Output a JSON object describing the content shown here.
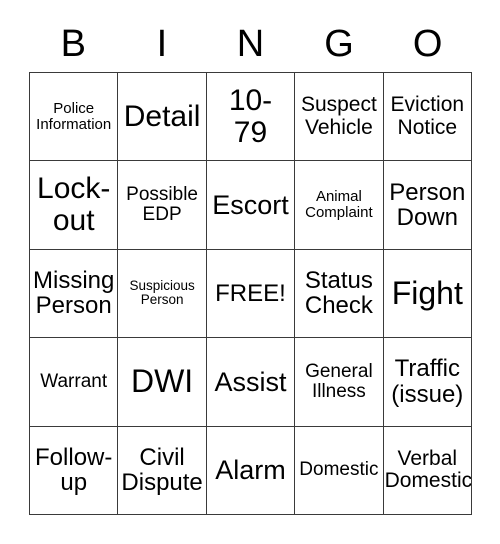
{
  "card": {
    "type": "bingo-card",
    "columns": 5,
    "rows": 5,
    "free_space_label": "FREE!",
    "border_color": "#3a3a3a",
    "background_color": "#ffffff",
    "text_color": "#000000"
  },
  "header": {
    "letters": [
      "B",
      "I",
      "N",
      "G",
      "O"
    ]
  },
  "grid": {
    "cells": [
      {
        "text": "Police\nInformation",
        "size": "fs-s",
        "name": "cell-police-information"
      },
      {
        "text": "Detail",
        "size": "fs-xxl",
        "name": "cell-detail"
      },
      {
        "text": "10-\n79",
        "size": "fs-xxl",
        "name": "cell-10-79"
      },
      {
        "text": "Suspect\nVehicle",
        "size": "fs-ml",
        "name": "cell-suspect-vehicle"
      },
      {
        "text": "Eviction\nNotice",
        "size": "fs-ml",
        "name": "cell-eviction-notice"
      },
      {
        "text": "Lock-\nout",
        "size": "fs-xxl",
        "name": "cell-lockout"
      },
      {
        "text": "Possible\nEDP",
        "size": "fs-m",
        "name": "cell-possible-edp"
      },
      {
        "text": "Escort",
        "size": "fs-xl",
        "name": "cell-escort"
      },
      {
        "text": "Animal\nComplaint",
        "size": "fs-s",
        "name": "cell-animal-complaint"
      },
      {
        "text": "Person\nDown",
        "size": "fs-l",
        "name": "cell-person-down"
      },
      {
        "text": "Missing\nPerson",
        "size": "fs-l",
        "name": "cell-missing-person"
      },
      {
        "text": "Suspicious\nPerson",
        "size": "fs-xs",
        "name": "cell-suspicious-person"
      },
      {
        "text": "FREE!",
        "size": "fs-l",
        "name": "cell-free-space"
      },
      {
        "text": "Status\nCheck",
        "size": "fs-l",
        "name": "cell-status-check"
      },
      {
        "text": "Fight",
        "size": "fs-huge",
        "name": "cell-fight"
      },
      {
        "text": "Warrant",
        "size": "fs-m",
        "name": "cell-warrant"
      },
      {
        "text": "DWI",
        "size": "fs-huge",
        "name": "cell-dwi"
      },
      {
        "text": "Assist",
        "size": "fs-xl",
        "name": "cell-assist"
      },
      {
        "text": "General\nIllness",
        "size": "fs-m",
        "name": "cell-general-illness"
      },
      {
        "text": "Traffic\n(issue)",
        "size": "fs-l",
        "name": "cell-traffic-issue"
      },
      {
        "text": "Follow-\nup",
        "size": "fs-l",
        "name": "cell-follow-up"
      },
      {
        "text": "Civil\nDispute",
        "size": "fs-l",
        "name": "cell-civil-dispute"
      },
      {
        "text": "Alarm",
        "size": "fs-xl",
        "name": "cell-alarm"
      },
      {
        "text": "Domestic",
        "size": "fs-m",
        "name": "cell-domestic"
      },
      {
        "text": "Verbal\nDomestic",
        "size": "fs-ml",
        "name": "cell-verbal-domestic"
      }
    ]
  }
}
